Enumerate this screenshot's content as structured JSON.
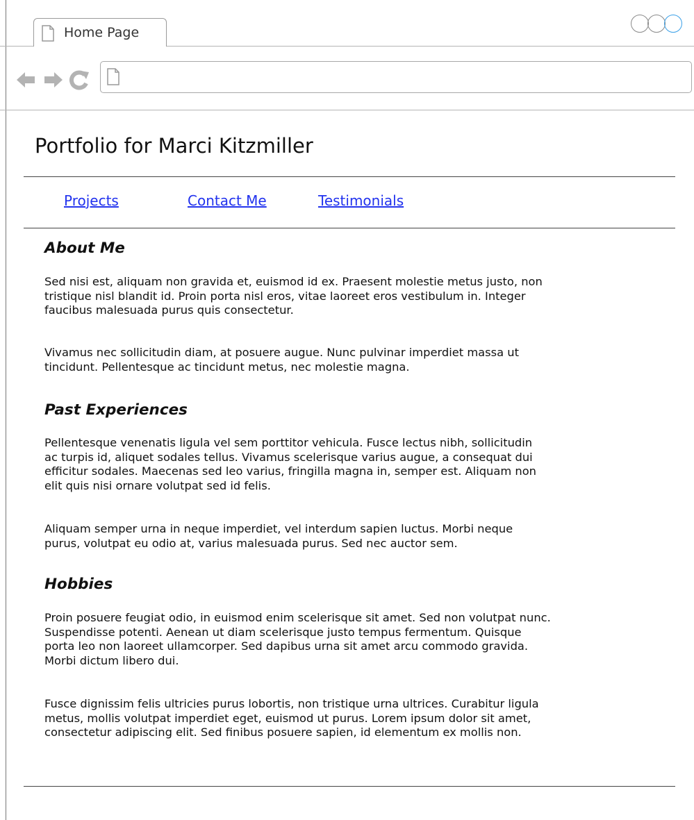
{
  "browser": {
    "tab_title": "Home Page",
    "icons": {
      "tab": "page-icon",
      "back": "back-arrow-icon",
      "forward": "forward-arrow-icon",
      "reload": "reload-icon",
      "address": "page-icon"
    }
  },
  "page": {
    "title": "Portfolio for Marci Kitzmiller",
    "nav": [
      "Projects",
      "Contact Me",
      "Testimonials"
    ],
    "link_color": "#2233ee",
    "sections": [
      {
        "heading": "About Me",
        "paragraphs": [
          [
            "Sed nisi est, aliquam non gravida et, euismod id ex. Praesent molestie metus justo, non",
            "tristique nisl blandit id. Proin porta nisl eros, vitae laoreet eros vestibulum in. Integer",
            "faucibus malesuada purus quis consectetur."
          ],
          [
            "Vivamus nec sollicitudin diam, at posuere augue. Nunc pulvinar imperdiet massa ut",
            "tincidunt. Pellentesque ac tincidunt metus, nec molestie magna."
          ]
        ]
      },
      {
        "heading": "Past Experiences",
        "paragraphs": [
          [
            "Pellentesque venenatis ligula vel sem porttitor vehicula. Fusce lectus nibh, sollicitudin",
            "ac turpis id, aliquet sodales tellus. Vivamus scelerisque varius augue, a consequat dui",
            "efficitur sodales. Maecenas sed leo varius, fringilla magna in, semper est. Aliquam non",
            "elit quis nisi ornare volutpat sed id felis."
          ],
          [
            "Aliquam semper urna in neque imperdiet, vel interdum sapien luctus. Morbi neque",
            "purus, volutpat eu odio at, varius malesuada purus. Sed nec auctor sem."
          ]
        ]
      },
      {
        "heading": "Hobbies",
        "paragraphs": [
          [
            "Proin posuere feugiat odio, in euismod enim scelerisque sit amet. Sed non volutpat nunc.",
            "Suspendisse potenti. Aenean ut diam scelerisque justo tempus fermentum. Quisque",
            "porta leo non laoreet ullamcorper. Sed dapibus urna sit amet arcu commodo gravida.",
            "Morbi dictum libero dui."
          ],
          [
            "Fusce dignissim felis ultricies purus lobortis, non tristique urna ultrices. Curabitur ligula",
            "metus, mollis volutpat imperdiet eget, euismod ut purus. Lorem ipsum dolor sit amet,",
            "consectetur adipiscing elit. Sed finibus posuere sapien, id elementum ex mollis non."
          ]
        ]
      }
    ]
  }
}
